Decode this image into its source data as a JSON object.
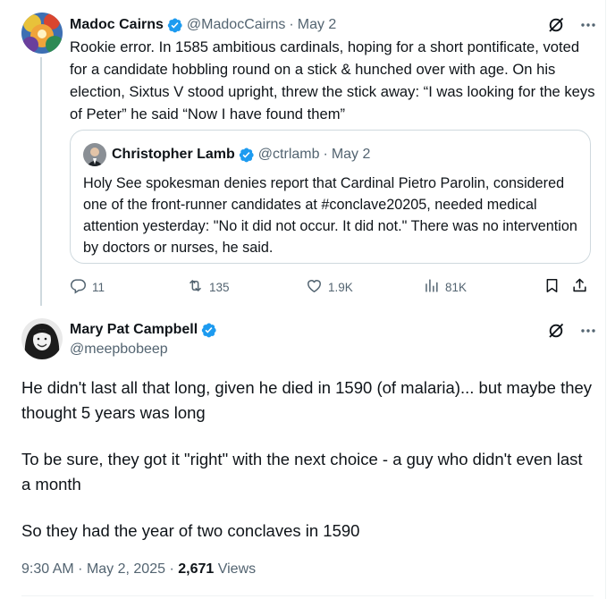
{
  "parent_tweet": {
    "author_name": "Madoc Cairns",
    "author_handle": "@MadocCairns",
    "separator": "·",
    "date": "May 2",
    "text": "Rookie error. In 1585 ambitious cardinals, hoping for a short pontificate, voted for a candidate hobbling round on a stick & hunched over with age. On his election, Sixtus V stood upright, threw the stick away: “I was looking for the keys of Peter” he said “Now I have found them”",
    "quoted_tweet": {
      "author_name": "Christopher Lamb",
      "author_handle": "@ctrlamb",
      "separator": "·",
      "date": "May 2",
      "text": "Holy See spokesman denies report that Cardinal Pietro Parolin, considered one of the front-runner candidates at #conclave20205, needed medical attention yesterday: \"No it did not occur. It did not.\" There was no intervention by doctors or nurses, he said."
    },
    "actions": {
      "replies": "11",
      "reposts": "135",
      "likes": "1.9K",
      "views": "81K"
    }
  },
  "main_tweet": {
    "author_name": "Mary Pat Campbell",
    "author_handle": "@meepbobeep",
    "paragraphs": [
      "He didn't last all that long, given he died in 1590 (of malaria)... but maybe they thought 5 years was long",
      "To be sure, they got it \"right\" with the next choice - a guy who didn't even last a month",
      "So they had the year of two conclaves in 1590"
    ],
    "time": "9:30 AM",
    "date_separator": "·",
    "date": "May 2, 2025",
    "views_separator": "·",
    "views_count": "2,671",
    "views_label": "Views"
  },
  "icons": {
    "verified_badge": "verified-badge-icon",
    "grok": "grok-icon",
    "more": "more-icon",
    "reply": "reply-icon",
    "repost": "repost-icon",
    "like": "like-icon",
    "views": "views-icon",
    "bookmark": "bookmark-icon",
    "share": "share-icon"
  },
  "colors": {
    "verified": "#1d9bf0",
    "primary_text": "#0f1419",
    "secondary_text": "#536471",
    "border": "#cfd9de"
  }
}
